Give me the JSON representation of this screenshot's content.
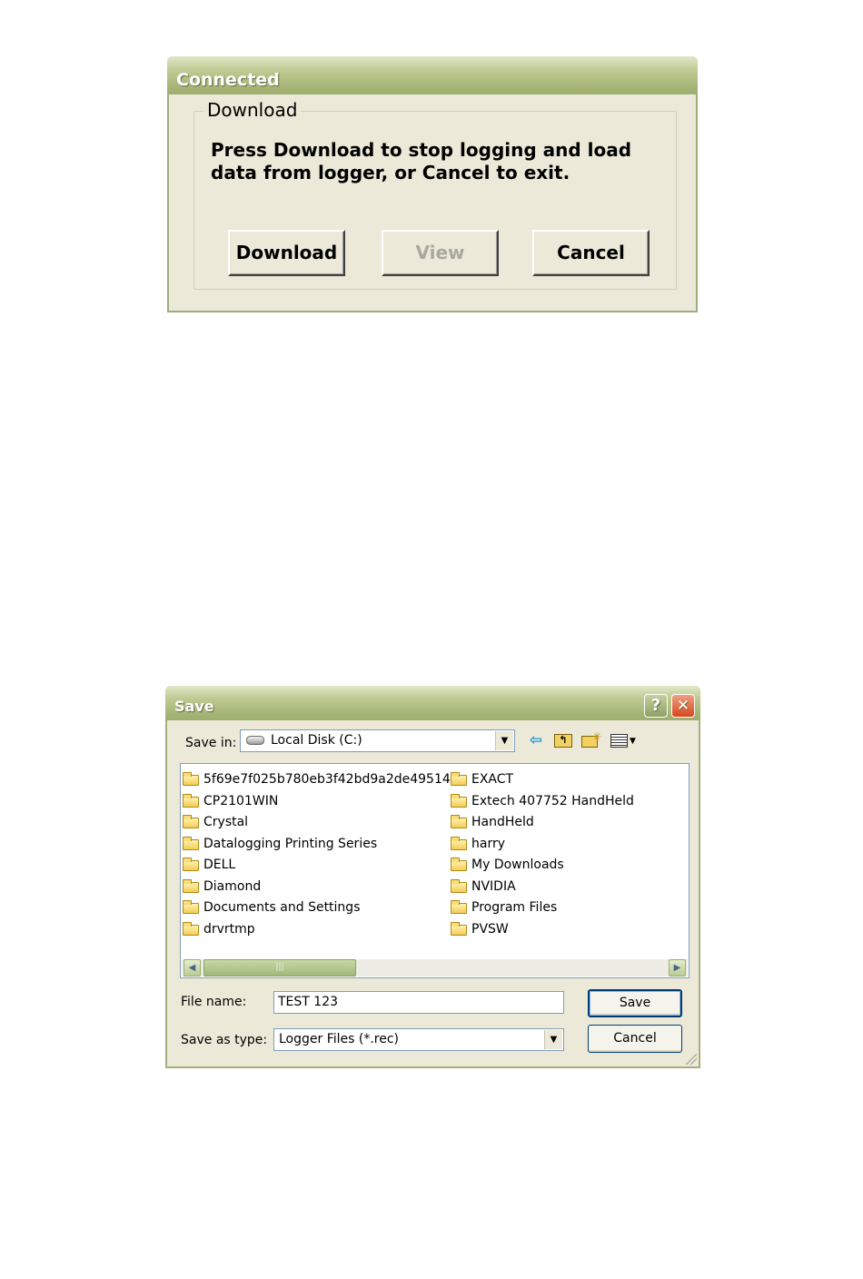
{
  "connected_dialog": {
    "title": "Connected",
    "group_label": "Download",
    "message": "Press Download to stop logging and load data from logger, or Cancel to exit.",
    "buttons": {
      "download": "Download",
      "view": "View",
      "cancel": "Cancel"
    }
  },
  "save_dialog": {
    "title": "Save",
    "title_buttons": {
      "help": "?",
      "close": "✕"
    },
    "save_in_label": "Save in:",
    "save_in_value": "Local Disk (C:)",
    "toolbar_icons": [
      "back-arrow-icon",
      "up-folder-icon",
      "new-folder-icon",
      "view-menu-icon"
    ],
    "folders_left": [
      "5f69e7f025b780eb3f42bd9a2de49514",
      "CP2101WIN",
      "Crystal",
      "Datalogging Printing Series",
      "DELL",
      "Diamond",
      "Documents and Settings",
      "drvrtmp"
    ],
    "folders_right": [
      "EXACT",
      "Extech 407752 HandHeld",
      "HandHeld",
      "harry",
      "My Downloads",
      "NVIDIA",
      "Program Files",
      "PVSW"
    ],
    "file_name_label": "File name:",
    "file_name_value": "TEST 123",
    "save_type_label": "Save as type:",
    "save_type_value": "Logger Files (*.rec)",
    "save_button": "Save",
    "cancel_button": "Cancel",
    "colors": {
      "title_bar": "#A6B577",
      "face": "#ECE9D8",
      "close": "#D9461E"
    }
  }
}
